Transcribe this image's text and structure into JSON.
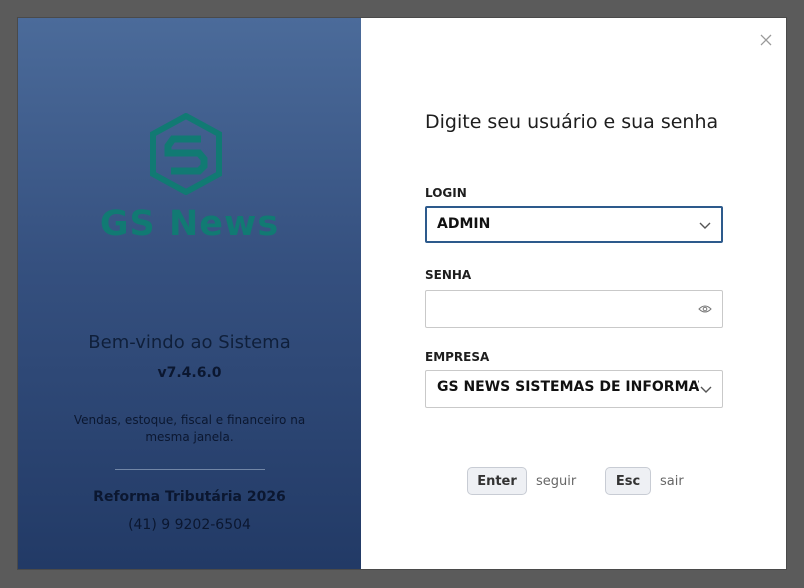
{
  "brand": {
    "name": "GS News",
    "welcome": "Bem-vindo ao Sistema",
    "version": "v7.4.6.0",
    "tagline": "Vendas, estoque, fiscal e financeiro na mesma janela.",
    "reform": "Reforma Tributária 2026",
    "phone": "(41) 9 9202-6504"
  },
  "form": {
    "heading": "Digite seu usuário e sua senha",
    "login_label": "LOGIN",
    "login_value": "ADMIN",
    "password_label": "SENHA",
    "password_value": "",
    "company_label": "EMPRESA",
    "company_value": "GS NEWS SISTEMAS DE INFORMATICA"
  },
  "shortcuts": [
    {
      "key": "Enter",
      "action": "seguir"
    },
    {
      "key": "Esc",
      "action": "sair"
    }
  ],
  "icons": {
    "close": "close-icon",
    "login_dropdown": "chevron-down-icon",
    "password_toggle": "eye-icon",
    "company_dropdown": "chevron-down-icon",
    "logo": "gs-logo-icon"
  },
  "colors": {
    "brand_teal": "#117a73",
    "panel_top": "#4b6b9a",
    "panel_bottom": "#223a66",
    "focus_border": "#2d5a8c"
  }
}
